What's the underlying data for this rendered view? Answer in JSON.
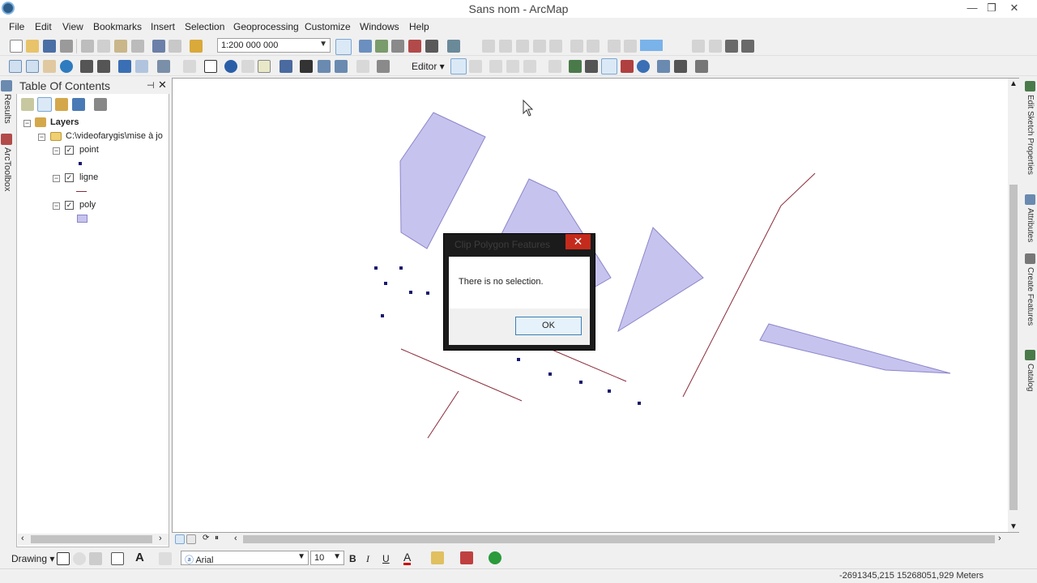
{
  "window": {
    "title": "Sans nom - ArcMap",
    "minimize": "—",
    "restore": "❐",
    "close": "✕"
  },
  "menu": [
    "File",
    "Edit",
    "View",
    "Bookmarks",
    "Insert",
    "Selection",
    "Geoprocessing",
    "Customize",
    "Windows",
    "Help"
  ],
  "toolbar": {
    "scale_value": "1:200 000 000",
    "editor_label": "Editor ▾"
  },
  "toc": {
    "title": "Table Of Contents",
    "layers_label": "Layers",
    "folder_label": "C:\\videofarygis\\mise à jo",
    "layers": [
      {
        "name": "point",
        "checked": true
      },
      {
        "name": "ligne",
        "checked": true
      },
      {
        "name": "poly",
        "checked": true
      }
    ]
  },
  "side_tabs": {
    "left": [
      "Results",
      "ArcToolbox"
    ],
    "right": [
      "Edit Sketch Properties",
      "Attributes",
      "Create Features",
      "Catalog"
    ]
  },
  "dialog": {
    "title": "Clip Polygon Features",
    "message": "There is no selection.",
    "ok_label": "OK",
    "close": "✕"
  },
  "drawing": {
    "drawing_label": "Drawing ▾",
    "font_name": "Arial",
    "font_size": "10",
    "bold": "B",
    "italic": "I",
    "underline": "U",
    "font_color_glyph": "A"
  },
  "status": {
    "coords": "-2691345,215  15268051,929 Meters"
  },
  "colors": {
    "poly_fill": "#c7c3ef",
    "poly_stroke": "#8a86c8",
    "line_color": "#8a2a3a",
    "point_color": "#1a1a6e",
    "dialog_close": "#c42b1c"
  }
}
